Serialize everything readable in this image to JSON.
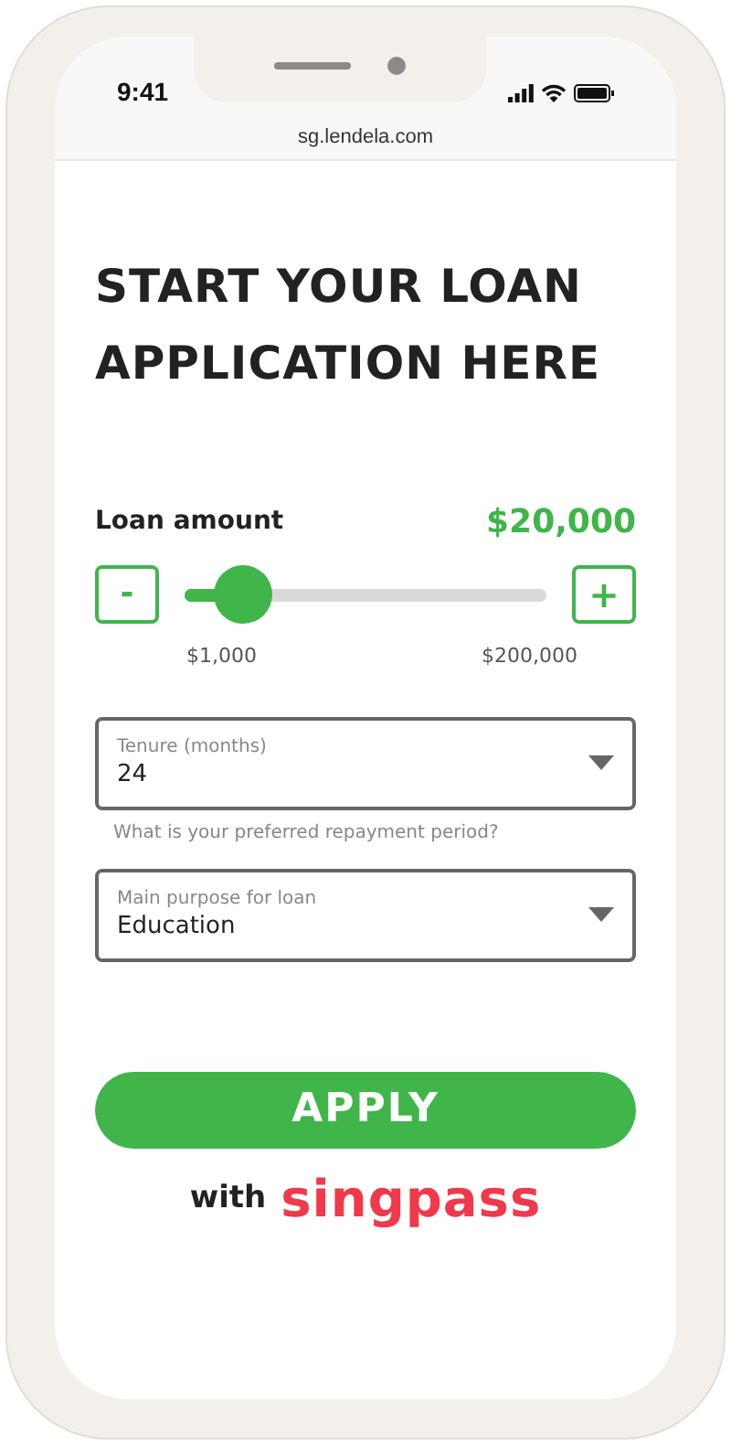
{
  "status_bar": {
    "time": "9:41"
  },
  "browser": {
    "url": "sg.lendela.com"
  },
  "heading": "START YOUR LOAN APPLICATION HERE",
  "loan_amount": {
    "label": "Loan amount",
    "value": "$20,000",
    "decrease": "-",
    "increase": "+",
    "level": 0.16,
    "min": "$1,000",
    "max": "$200,000"
  },
  "fields": [
    {
      "label": "Tenure (months)",
      "value": "24",
      "helper": "What is your preferred repayment period?"
    },
    {
      "label": "Main purpose for loan",
      "value": "Education"
    }
  ],
  "apply_button": "APPLY",
  "with_label": "with",
  "brand": "singpass"
}
